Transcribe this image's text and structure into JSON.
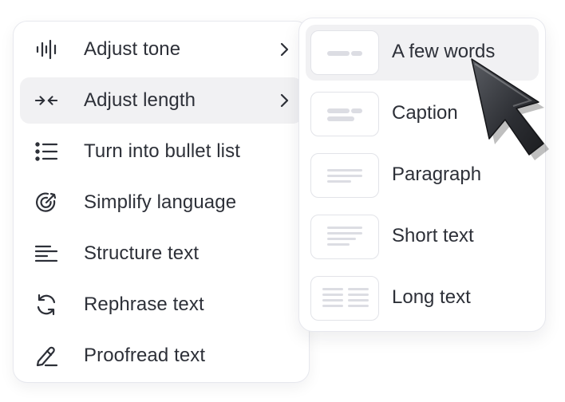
{
  "menu": {
    "items": [
      {
        "label": "Adjust tone",
        "icon": "waveform-icon",
        "has_submenu": true
      },
      {
        "label": "Adjust length",
        "icon": "compress-arrows-icon",
        "has_submenu": true,
        "active": true
      },
      {
        "label": "Turn into bullet list",
        "icon": "bullet-list-icon"
      },
      {
        "label": "Simplify language",
        "icon": "target-icon"
      },
      {
        "label": "Structure text",
        "icon": "align-left-icon"
      },
      {
        "label": "Rephrase text",
        "icon": "refresh-icon"
      },
      {
        "label": "Proofread text",
        "icon": "pen-icon"
      }
    ]
  },
  "submenu": {
    "options": [
      {
        "label": "A few words",
        "thumbnail": "few-words",
        "active": true
      },
      {
        "label": "Caption",
        "thumbnail": "caption"
      },
      {
        "label": "Paragraph",
        "thumbnail": "paragraph"
      },
      {
        "label": "Short text",
        "thumbnail": "short-text"
      },
      {
        "label": "Long text",
        "thumbnail": "long-text"
      }
    ]
  },
  "colors": {
    "text": "#2d3038",
    "icon": "#2d3038",
    "active_bg": "#f1f1f3",
    "border": "#e7e8ee",
    "thumb_bar": "#dcdde3"
  }
}
